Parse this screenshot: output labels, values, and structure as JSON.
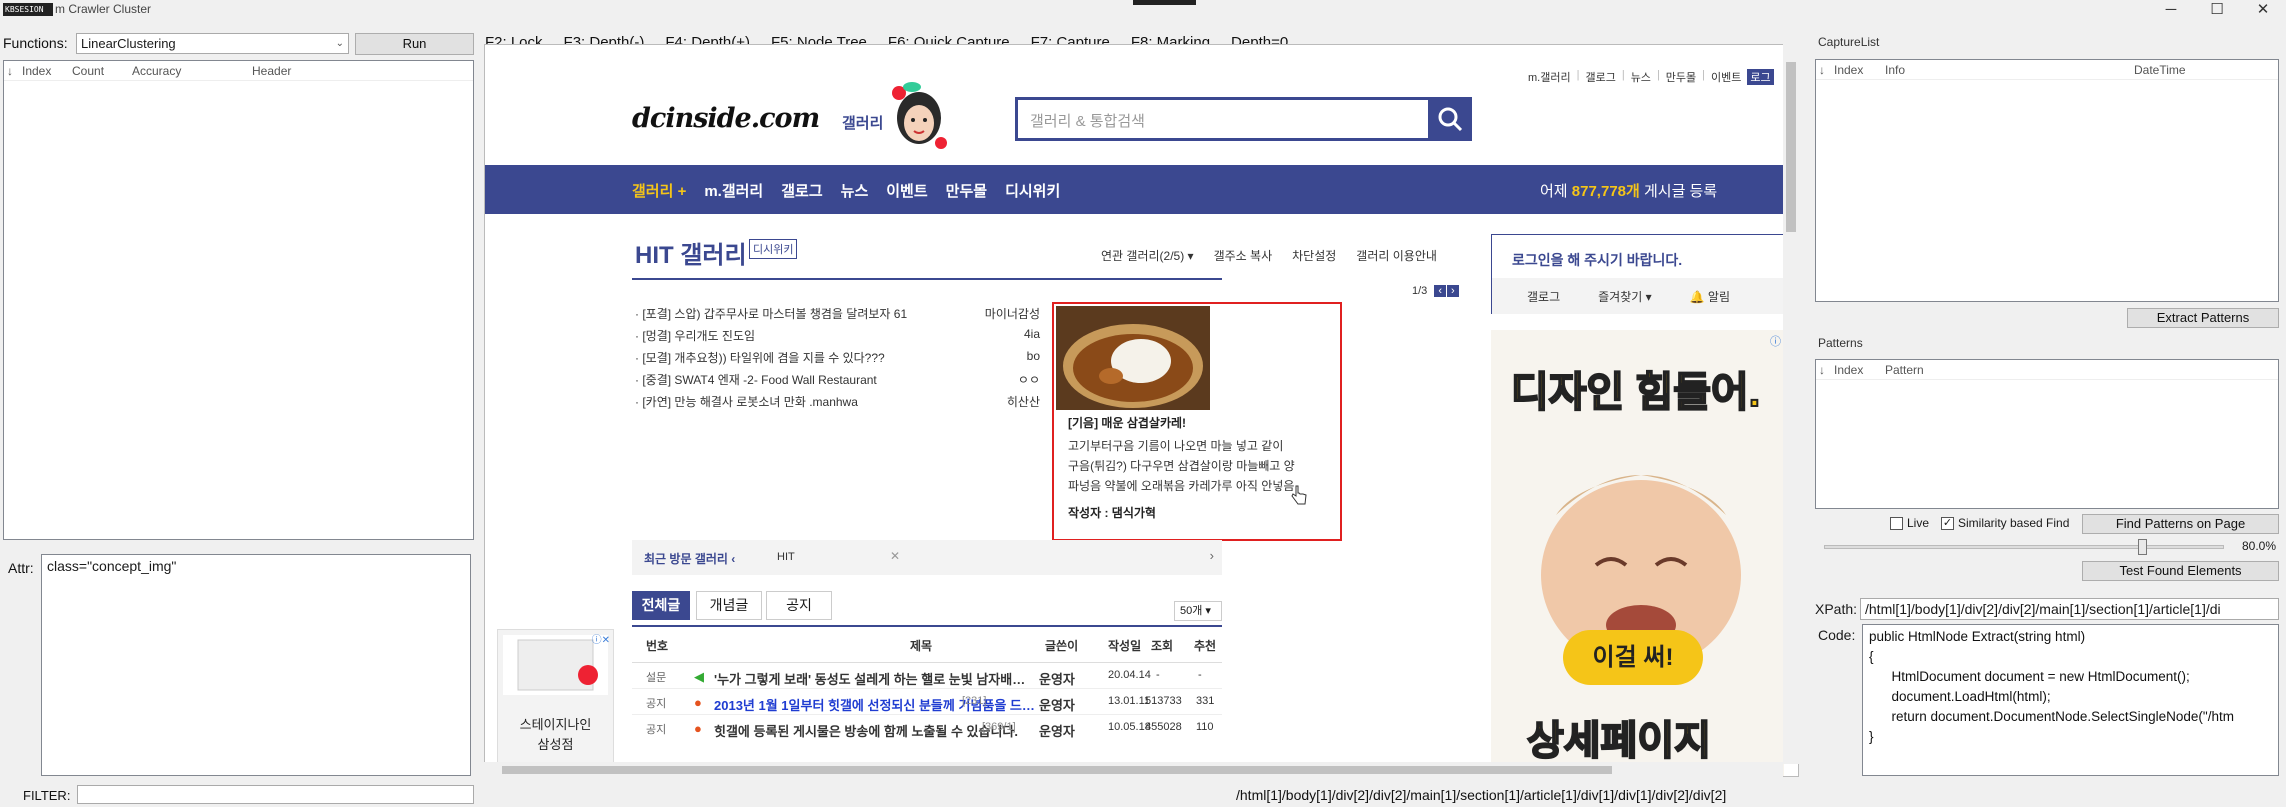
{
  "window": {
    "title": "m Crawler Cluster",
    "icon_text": "KBSESION",
    "controls": [
      "─",
      "☐",
      "✕"
    ]
  },
  "left": {
    "functions_label": "Functions:",
    "functions_value": "LinearClustering",
    "run_label": "Run",
    "columns": [
      "Index",
      "Count",
      "Accuracy",
      "Header"
    ],
    "attr_label": "Attr:",
    "attr_value": "class=\"concept_img\"",
    "filter_label": "FILTER:"
  },
  "shortcuts": [
    "F2: Lock",
    "F3: Depth(-)",
    "F4: Depth(+)",
    "F5: Node Tree",
    "F6: Quick Capture",
    "F7: Capture",
    "F8: Marking",
    "Depth=0"
  ],
  "page": {
    "top_links": [
      "m.갤러리",
      "갤로그",
      "뉴스",
      "만두몰",
      "이벤트",
      "로그"
    ],
    "logo": "dcinside.com",
    "logo_sub": "갤러리",
    "search_placeholder": "갤러리 & 통합검색",
    "nav": [
      "갤러리 +",
      "m.갤러리",
      "갤로그",
      "뉴스",
      "이벤트",
      "만두몰",
      "디시위키"
    ],
    "nav_right_prefix": "어제",
    "nav_right_count": "877,778개",
    "nav_right_suffix": "게시글 등록",
    "hit_title": "HIT 갤러리",
    "hit_badge": "디시위키",
    "hit_menu": [
      "연관 갤러리(2/5) ▾",
      "갤주소 복사",
      "차단설정",
      "갤러리 이용안내"
    ],
    "pager": "1/3",
    "hit_list": [
      {
        "title": "· [포결] 스압) 갑주무사로 마스터볼 챙겸을 달려보자 61",
        "author": "마이너감성"
      },
      {
        "title": "· [멍결] 우리개도 진도임",
        "author": "4ia"
      },
      {
        "title": "· [모결] 개추요청)) 타일위에 겸을 지를 수 있다???",
        "author": "bo"
      },
      {
        "title": "· [중결] SWAT4 엔재 -2- Food Wall Restaurant",
        "author": "ㅇㅇ"
      },
      {
        "title": "· [카연] 만능 해결사 로봇소녀 만화 .manhwa",
        "author": "히산산"
      }
    ],
    "featured_title": "[기음] 매운 삼겹살카레!",
    "featured_body": [
      "고기부터구음 기름이 나오면 마늘 넣고 같이",
      "구음(튀김?) 다구우면 삼겹살이랑 마늘빼고 양",
      "파넝음 약불에 오래볶음 카레가루 아직 안넣음"
    ],
    "featured_author": "작성자 : 댐식가혁",
    "login_prompt": "로그인을 해 주시기 바랍니다.",
    "login_links": [
      "갤로그",
      "즐겨찾기 ▾",
      "🔔 알림"
    ],
    "recent_label": "최근 방문 갤러리 ‹",
    "recent_item": "HIT",
    "tabs": [
      "전체글",
      "개념글",
      "공지"
    ],
    "per_page": "50개",
    "table_headers": [
      "번호",
      "제목",
      "글쓴이",
      "작성일",
      "조회",
      "추천"
    ],
    "rows": [
      {
        "num": "설문",
        "title": "'누가 그렇게 보래' 동성도 설레게 하는 핼로 눈빛 남자배…",
        "count": "",
        "author": "운영자",
        "date": "20.04.14",
        "views": "-",
        "rec": "-"
      },
      {
        "num": "공지",
        "title": "2013년 1월 1일부터 힛갤에 선정되신 분들께 기념품을 드…",
        "count": "[231]",
        "author": "운영자",
        "date": "13.01.11",
        "views": "513733",
        "rec": "331"
      },
      {
        "num": "공지",
        "title": "힛갤에 등록된 게시물은 방송에 함께 노출될 수 있습니다.",
        "count": "[369/1]",
        "author": "운영자",
        "date": "10.05.18",
        "views": "455028",
        "rec": "110"
      }
    ],
    "left_ad_text": [
      "스테이지나인",
      "삼성점"
    ],
    "right_ad_top": "디자인 힘들어.",
    "right_ad_bubble": "이걸 써!",
    "right_ad_bottom": "상세페이지"
  },
  "right": {
    "capture_title": "CaptureList",
    "capture_columns": [
      "Index",
      "Info",
      "DateTime"
    ],
    "extract_label": "Extract Patterns",
    "patterns_title": "Patterns",
    "pattern_columns": [
      "Index",
      "Pattern"
    ],
    "live_label": "Live",
    "similarity_label": "Similarity based Find",
    "find_label": "Find Patterns on Page",
    "slider_value": "80.0%",
    "slider_fraction": 0.8,
    "test_label": "Test Found Elements",
    "xpath_label": "XPath:",
    "xpath_value": "/html[1]/body[1]/div[2]/div[2]/main[1]/section[1]/article[1]/di",
    "code_label": "Code:",
    "code_value": "public HtmlNode Extract(string html)\n{\n      HtmlDocument document = new HtmlDocument();\n      document.LoadHtml(html);\n      return document.DocumentNode.SelectSingleNode(\"/htm\n}"
  },
  "status": {
    "xpath": "/html[1]/body[1]/div[2]/div[2]/main[1]/section[1]/article[1]/div[1]/div[1]/div[2]/div[2]"
  },
  "colors": {
    "accent": "#3b4890",
    "highlight": "#e02020",
    "gold": "#f5c518"
  }
}
